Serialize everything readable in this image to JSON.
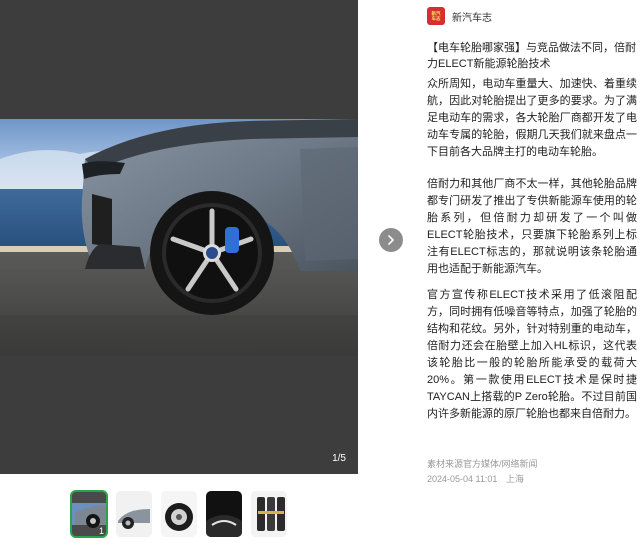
{
  "gallery": {
    "counter": "1/5",
    "active_index": 1,
    "thumbnails": [
      {
        "number": "1",
        "active": true,
        "depicts": "car-wheel"
      },
      {
        "number": "",
        "active": false,
        "depicts": "car-side"
      },
      {
        "number": "",
        "active": false,
        "depicts": "tire-closeup"
      },
      {
        "number": "",
        "active": false,
        "depicts": "tire-tread"
      },
      {
        "number": "",
        "active": false,
        "depicts": "tire-stack"
      }
    ],
    "next_icon": "chevron-right-icon"
  },
  "author": {
    "avatar_text": [
      "新汽",
      "车志"
    ],
    "name": "新汽车志"
  },
  "article": {
    "title": "【电车轮胎哪家强】与竞品做法不同，倍耐力ELECT新能源轮胎技术",
    "paragraphs": [
      "众所周知，电动车重量大、加速快、着重续航，因此对轮胎提出了更多的要求。为了满足电动车的需求，各大轮胎厂商都开发了电动车专属的轮胎，假期几天我们就来盘点一下目前各大品牌主打的电动车轮胎。",
      "倍耐力和其他厂商不太一样，其他轮胎品牌都专门研发了推出了专供新能源车使用的轮胎系列，但倍耐力却研发了一个叫做ELECT轮胎技术，只要旗下轮胎系列上标注有ELECT标志的，那就说明该条轮胎通用也适配于新能源汽车。",
      "官方宣传称ELECT技术采用了低滚阻配方，同时拥有低噪音等特点，加强了轮胎的结构和花纹。另外，针对特别重的电动车，倍耐力还会在胎壁上加入HL标识，这代表该轮胎比一般的轮胎所能承受的载荷大20%。第一款使用ELECT技术是保时捷TAYCAN上搭载的P Zero轮胎。不过目前国内许多新能源的原厂轮胎也都来自倍耐力。"
    ],
    "source": "素材来源官方媒体/网络新闻",
    "date": "2024-05-04 11:01",
    "location": "上海"
  },
  "colors": {
    "gallery_bg": "#3d3d3d",
    "accent_green": "#2ba24c",
    "avatar_red": "#d62f2f",
    "meta_gray": "#9a9a9a"
  }
}
